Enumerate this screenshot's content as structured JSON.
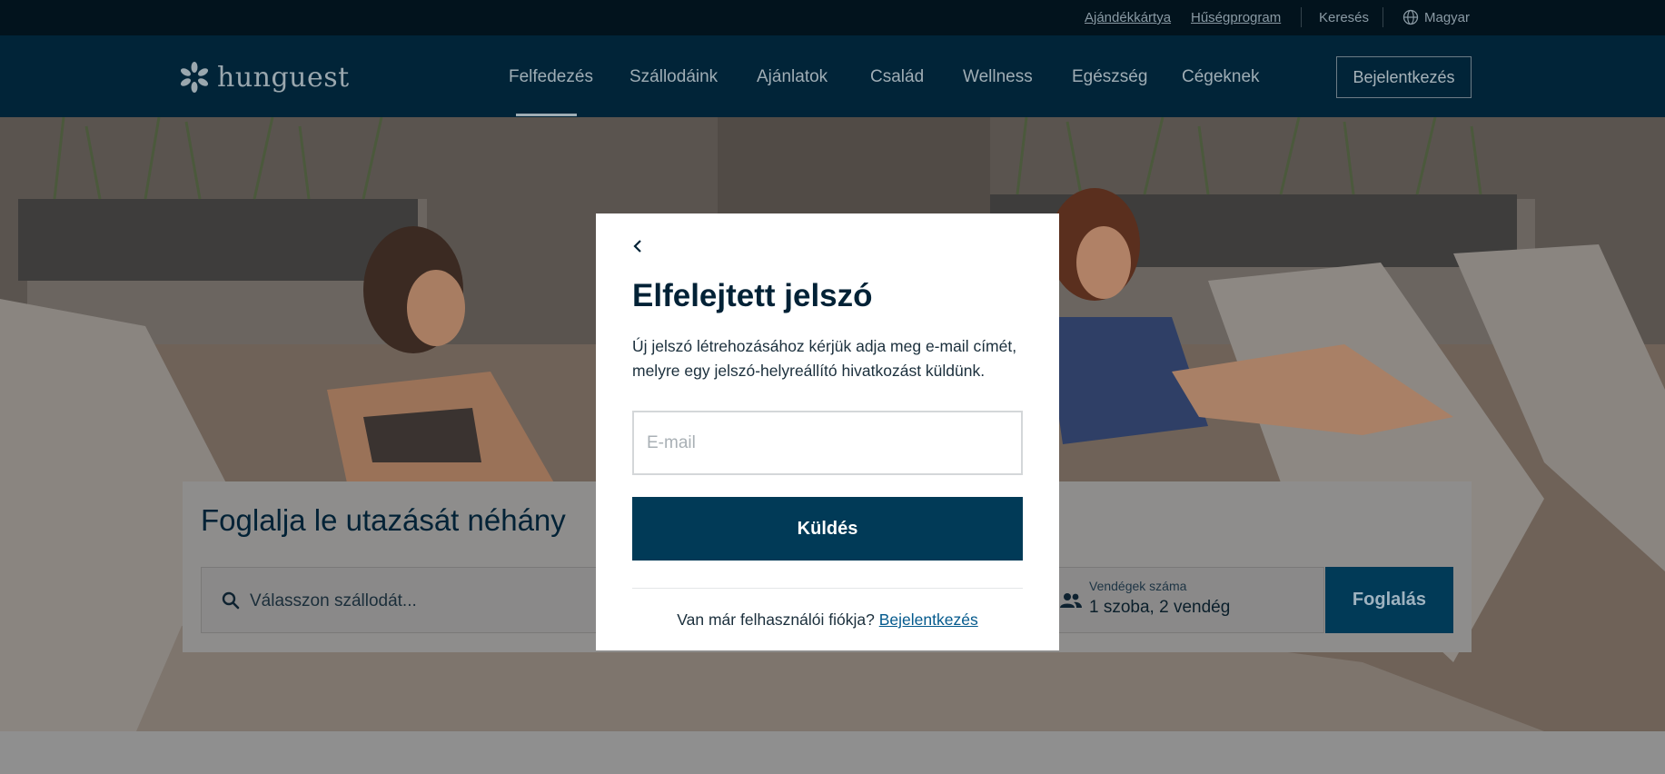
{
  "topbar": {
    "gift_card": "Ajándékkártya",
    "loyalty": "Hűségprogram",
    "search": "Keresés",
    "language": "Magyar"
  },
  "nav": {
    "logo_text": "hunguest",
    "items": [
      {
        "label": "Felfedezés",
        "active": true
      },
      {
        "label": "Szállodáink",
        "active": false
      },
      {
        "label": "Ajánlatok",
        "active": false
      },
      {
        "label": "Család",
        "active": false
      },
      {
        "label": "Wellness",
        "active": false
      },
      {
        "label": "Egészség",
        "active": false
      },
      {
        "label": "Cégeknek",
        "active": false
      }
    ],
    "login_label": "Bejelentkezés"
  },
  "booking": {
    "title": "Foglalja le utazását néhány",
    "hotel_placeholder": "Válasszon szállodát...",
    "guests_label": "Vendégek száma",
    "guests_value": "1 szoba, 2 vendég",
    "book_label": "Foglalás"
  },
  "modal": {
    "title": "Elfelejtett jelszó",
    "description": "Új jelszó létrehozásához kérjük adja meg e-mail címét, melyre egy jelszó-helyreállító hivatkozást küldünk.",
    "email_placeholder": "E-mail",
    "email_value": "",
    "send_label": "Küldés",
    "footer_text": "Van már felhasználói fiókja?",
    "footer_link": "Bejelentkezés"
  },
  "colors": {
    "navy": "#012438",
    "topbar": "#02131d",
    "primary_button": "#013a57",
    "link": "#045a8d"
  }
}
